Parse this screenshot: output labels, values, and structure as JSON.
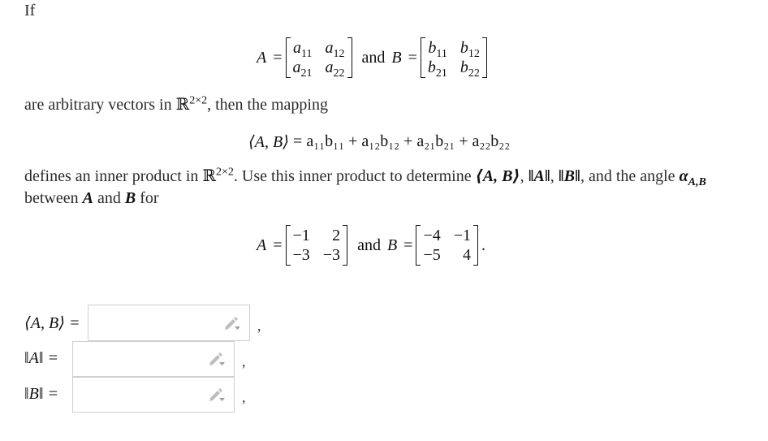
{
  "intro": "If",
  "definition": {
    "A_symbol": "A",
    "B_symbol": "B",
    "eq": "=",
    "and": "and",
    "A_entries": [
      [
        "a",
        "11"
      ],
      [
        "a",
        "12"
      ],
      [
        "a",
        "21"
      ],
      [
        "a",
        "22"
      ]
    ],
    "B_entries": [
      [
        "b",
        "11"
      ],
      [
        "b",
        "12"
      ],
      [
        "b",
        "21"
      ],
      [
        "b",
        "22"
      ]
    ]
  },
  "line2": {
    "pre": "are arbitrary vectors in ",
    "space": "ℝ",
    "space_sup": "2×2",
    "post": ", then the mapping"
  },
  "inner_product_formula": {
    "lhs": "⟨A, B⟩",
    "rhs": "= a₁₁b₁₁ + a₁₂b₁₂ + a₂₁b₂₁ + a₂₂b₂₂"
  },
  "paragraph": {
    "line1_pre": "defines an inner product in ",
    "space": "ℝ",
    "space_sup": "2×2",
    "line1_mid": ". Use this inner product to determine ",
    "ip": "⟨A, B⟩",
    "sep1": ", ",
    "normA": "‖A‖",
    "sep2": ", ",
    "normB": "‖B‖",
    "line1_post": ", and the angle ",
    "alpha": "α",
    "alpha_sub": "A,B",
    "line2_pre": "between ",
    "A": "A",
    "and": " and ",
    "B": "B",
    "line2_post": " for"
  },
  "given": {
    "A_symbol": "A",
    "B_symbol": "B",
    "eq": "=",
    "and": "and",
    "A": [
      "−1",
      "2",
      "−3",
      "−3"
    ],
    "B": [
      "−4",
      "−1",
      "−5",
      "4"
    ],
    "end": "."
  },
  "answers": [
    {
      "label": "⟨A, B⟩ =",
      "value": "",
      "placeholder": "",
      "suffix": ","
    },
    {
      "label": "‖A‖ =",
      "value": "",
      "placeholder": "",
      "suffix": ","
    },
    {
      "label": "‖B‖ =",
      "value": "",
      "placeholder": "",
      "suffix": ","
    }
  ],
  "icons": {
    "answer_tool": "pencil-dropdown-icon"
  }
}
